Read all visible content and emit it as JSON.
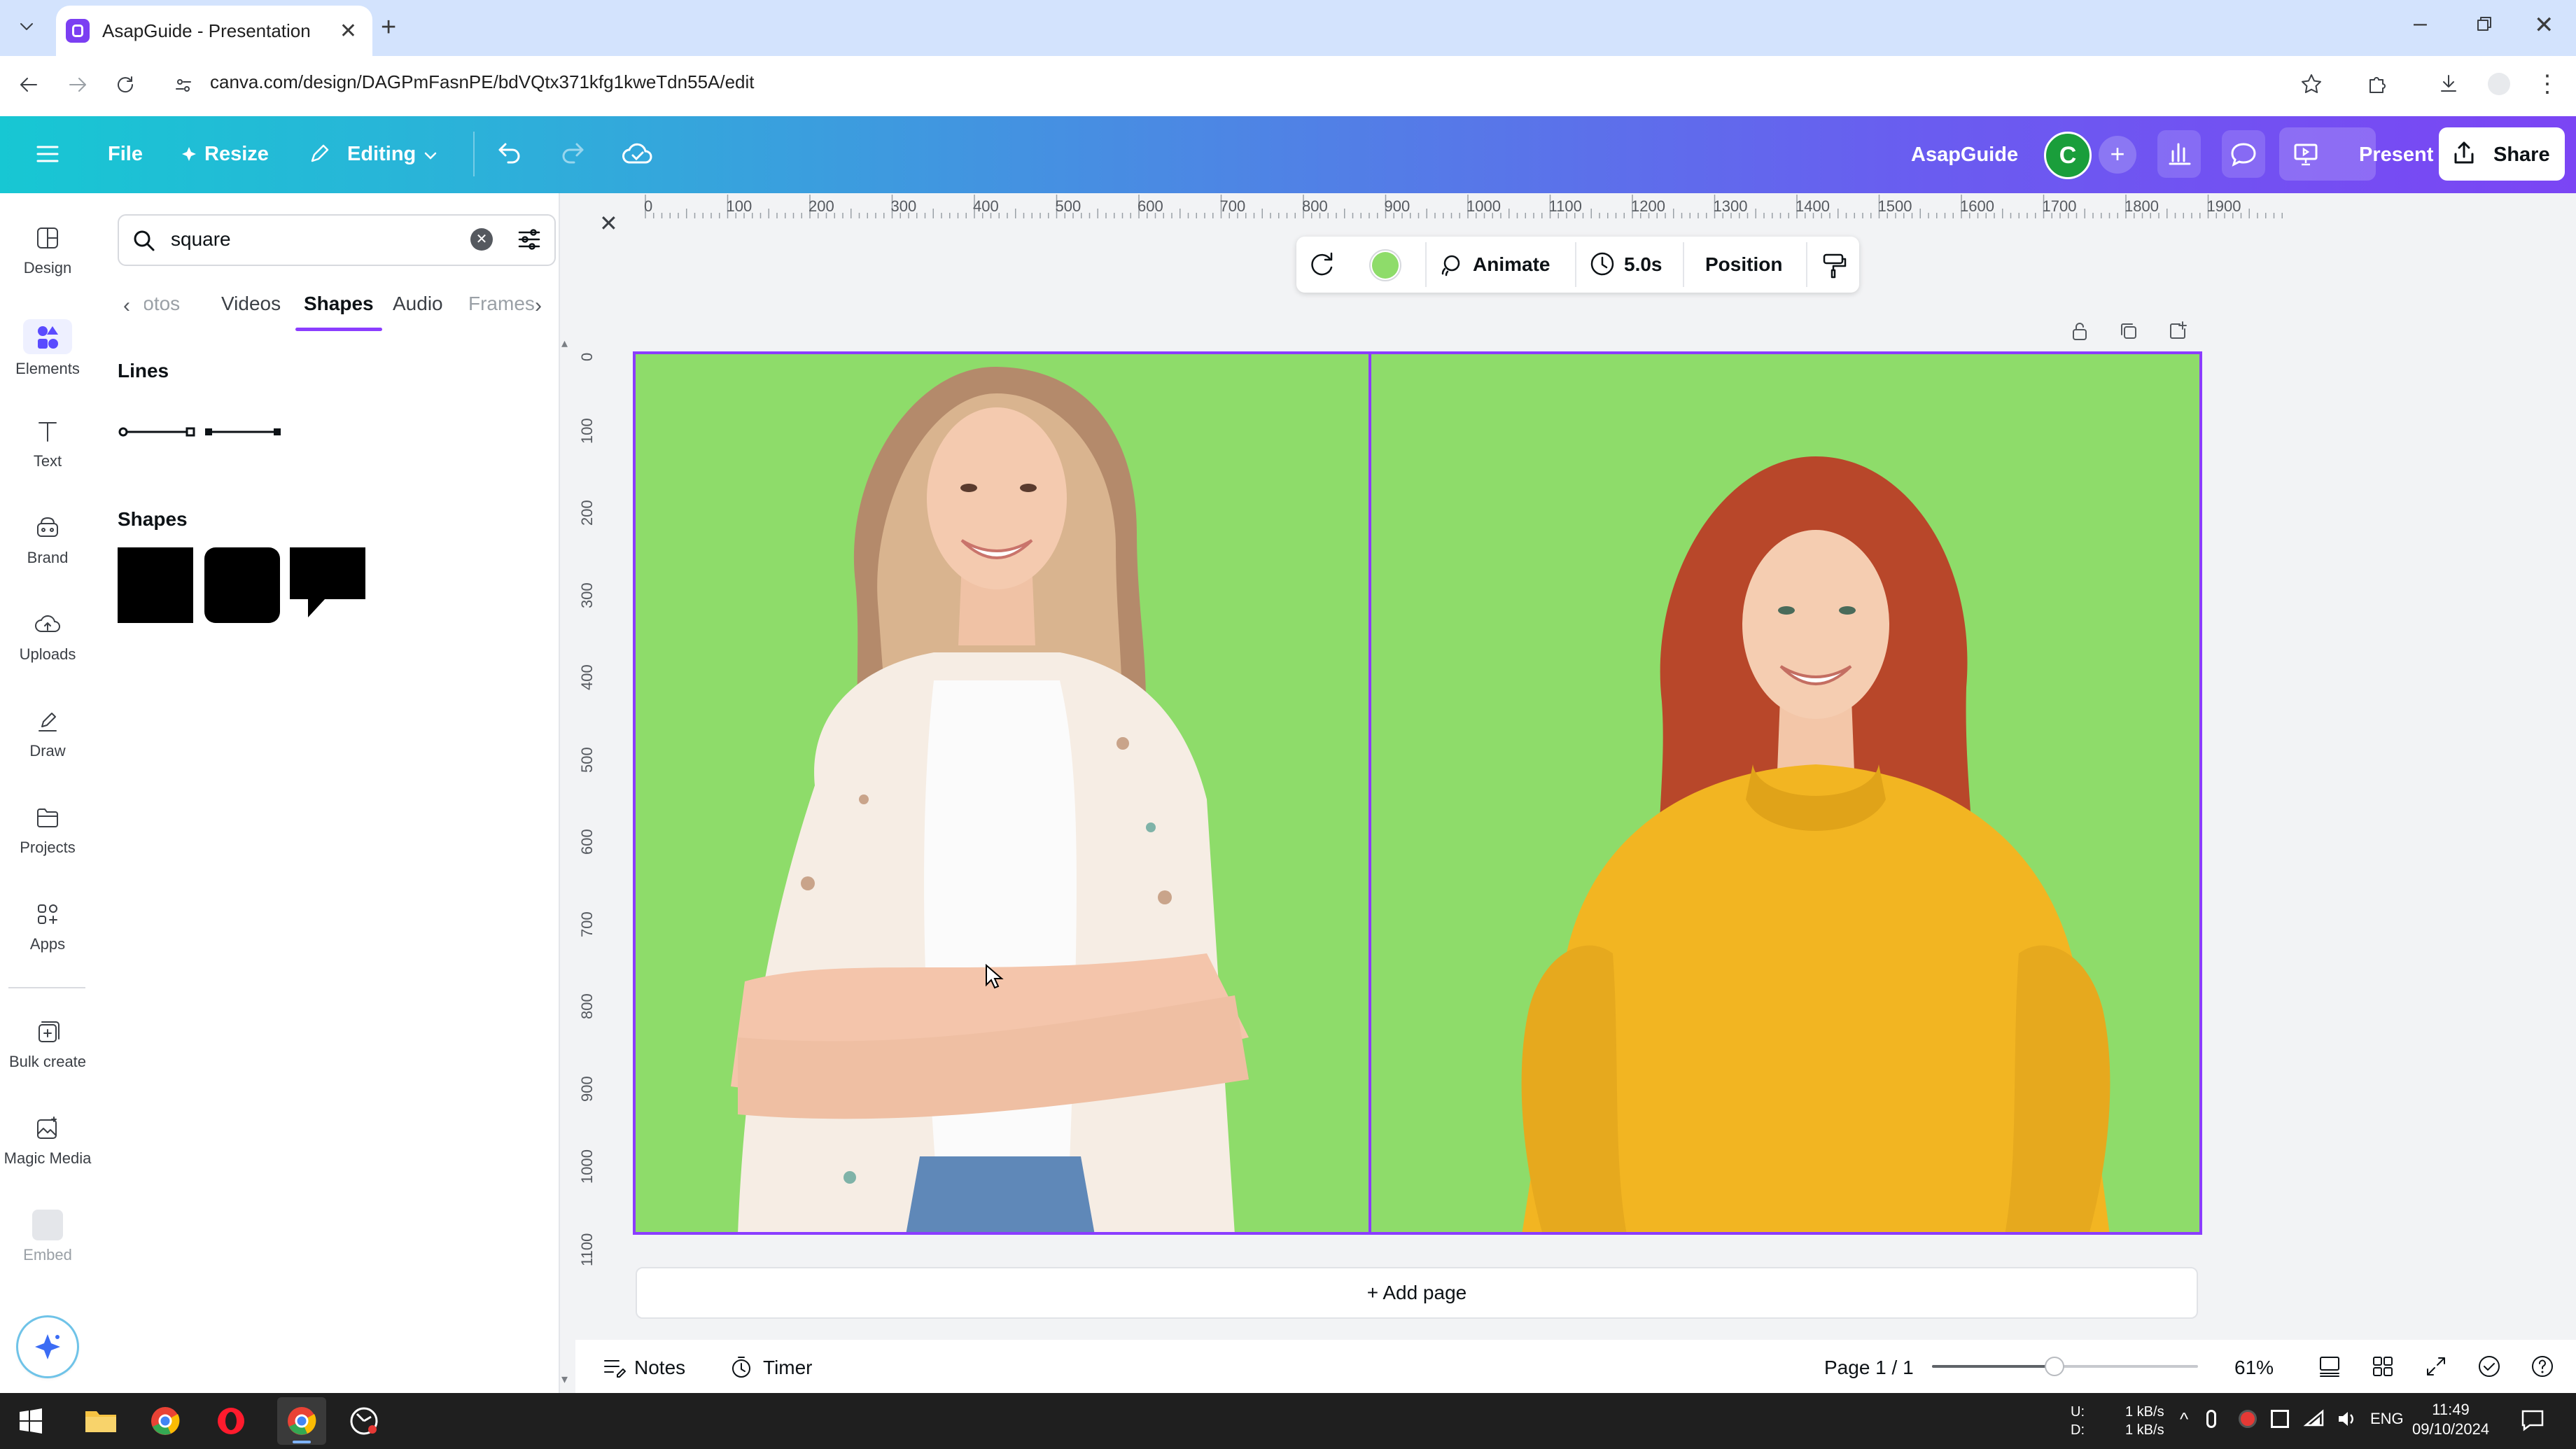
{
  "browser": {
    "tab_title": "AsapGuide - Presentation",
    "url": "canva.com/design/DAGPmFasnPE/bdVQtx371kfg1kweTdn55A/edit"
  },
  "header": {
    "file_label": "File",
    "resize_label": "Resize",
    "editing_label": "Editing",
    "team_name": "AsapGuide",
    "avatar_letter": "C",
    "present_label": "Present",
    "share_label": "Share",
    "colors": {
      "accent": "#8b3dff",
      "avatar": "#1a9e3b"
    }
  },
  "rail": {
    "items": [
      {
        "label": "Design",
        "icon": "layout-icon"
      },
      {
        "label": "Elements",
        "icon": "elements-icon"
      },
      {
        "label": "Text",
        "icon": "text-icon"
      },
      {
        "label": "Brand",
        "icon": "brand-icon"
      },
      {
        "label": "Uploads",
        "icon": "cloud-upload-icon"
      },
      {
        "label": "Draw",
        "icon": "pen-icon"
      },
      {
        "label": "Projects",
        "icon": "folder-icon"
      },
      {
        "label": "Apps",
        "icon": "apps-icon"
      },
      {
        "label": "Bulk create",
        "icon": "bulk-create-icon"
      },
      {
        "label": "Magic Media",
        "icon": "magic-media-icon"
      },
      {
        "label": "Embed",
        "icon": "embed-icon"
      }
    ]
  },
  "panel": {
    "search_value": "square",
    "tabs": [
      "Photos",
      "Videos",
      "Shapes",
      "Audio",
      "Frames"
    ],
    "active_tab": "Shapes",
    "lines_title": "Lines",
    "shapes_title": "Shapes"
  },
  "ruler": {
    "top": [
      "0",
      "100",
      "200",
      "300",
      "400",
      "500",
      "600",
      "700",
      "800",
      "900",
      "1000",
      "1100",
      "1200",
      "1300",
      "1400",
      "1500",
      "1600",
      "1700",
      "1800",
      "1900"
    ],
    "left": [
      "0",
      "100",
      "200",
      "300",
      "400",
      "500",
      "600",
      "700",
      "800",
      "900",
      "1000",
      "1100"
    ]
  },
  "context_toolbar": {
    "animate_label": "Animate",
    "duration_label": "5.0s",
    "position_label": "Position",
    "fill_color": "#8edc6a"
  },
  "canvas": {
    "add_page_label": "+ Add page"
  },
  "bottom": {
    "notes_label": "Notes",
    "timer_label": "Timer",
    "page_indicator": "Page 1 / 1",
    "zoom_label": "61%",
    "zoom_fraction": 0.46
  },
  "taskbar": {
    "net_up_label": "U:",
    "net_down_label": "D:",
    "net_up": "1 kB/s",
    "net_down": "1 kB/s",
    "language": "ENG",
    "time": "11:49",
    "date": "09/10/2024"
  }
}
